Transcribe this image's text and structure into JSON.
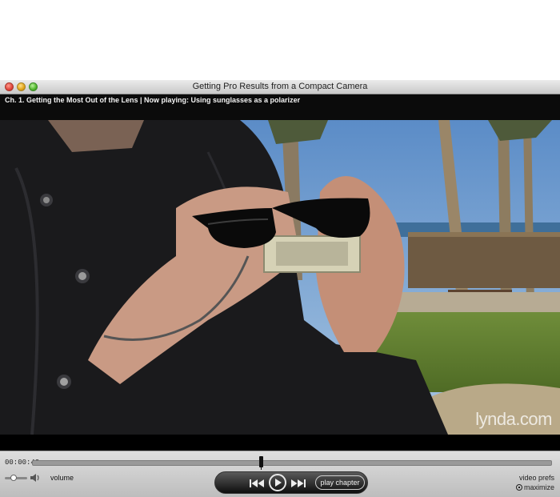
{
  "window": {
    "title": "Getting Pro Results from a Compact Camera"
  },
  "now_playing": {
    "text": "Ch. 1. Getting the Most Out of the Lens | Now playing: Using sunglasses as a polarizer"
  },
  "video": {
    "watermark": "lynda.com"
  },
  "controls": {
    "timecode": "00:00:43",
    "progress_fraction": 0.44,
    "volume_fraction": 0.4,
    "volume_label": "volume",
    "play_chapter_label": "play chapter",
    "video_prefs_label": "video prefs",
    "maximize_label": "maximize"
  },
  "icons": {
    "close": "close-dot",
    "minimize": "minimize-dot",
    "zoom": "zoom-dot",
    "speaker": "speaker-icon",
    "previous": "skip-back-icon",
    "play": "play-icon",
    "next": "skip-forward-icon",
    "maximize": "maximize-icon"
  },
  "colors": {
    "close": "#e0443a",
    "minimize": "#e0a317",
    "zoom": "#4fb52b",
    "transport_bg": "#111111"
  }
}
